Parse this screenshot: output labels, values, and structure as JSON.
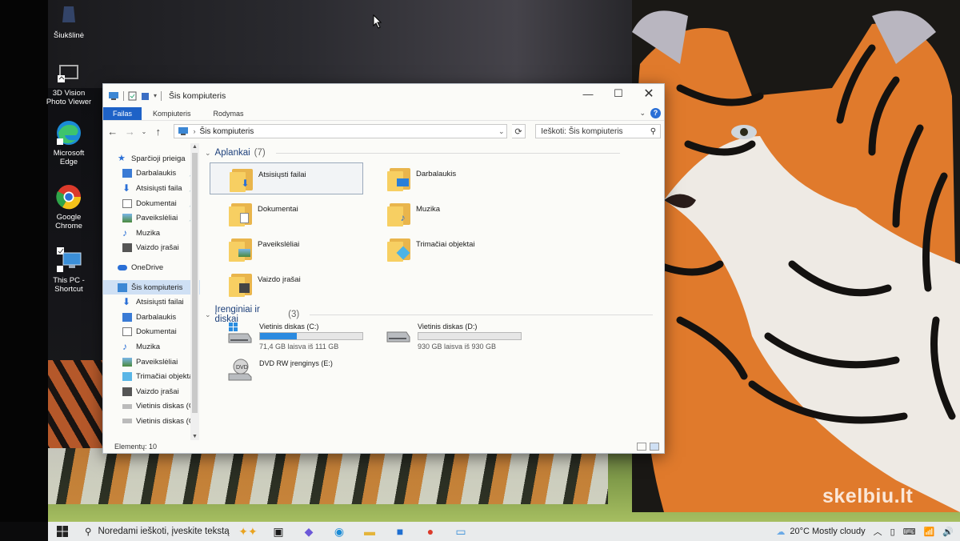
{
  "desktop": {
    "icons": [
      {
        "name": "recycle-bin",
        "label": "Šiukšlinė"
      },
      {
        "name": "3d-vision-photo-viewer",
        "label": "3D Vision Photo Viewer"
      },
      {
        "name": "microsoft-edge",
        "label": "Microsoft Edge"
      },
      {
        "name": "google-chrome",
        "label": "Google Chrome"
      },
      {
        "name": "this-pc-shortcut",
        "label": "This PC - Shortcut"
      }
    ],
    "watermark": "skelbiu.lt"
  },
  "explorer": {
    "title": "Šis kompiuteris",
    "ribbon_tabs": [
      "Failas",
      "Kompiuteris",
      "Rodymas"
    ],
    "address": "Šis kompiuteris",
    "search_placeholder": "Ieškoti: Šis kompiuteris",
    "nav": {
      "quick_access": "Sparčioji prieiga",
      "quick_items": [
        "Darbalaukis",
        "Atsisiųsti faila",
        "Dokumentai",
        "Paveikslėliai",
        "Muzika",
        "Vaizdo įrašai"
      ],
      "onedrive": "OneDrive",
      "this_pc": "Šis kompiuteris",
      "pc_items": [
        "Atsisiųsti failai",
        "Darbalaukis",
        "Dokumentai",
        "Muzika",
        "Paveikslėliai",
        "Trimačiai objekta",
        "Vaizdo įrašai",
        "Vietinis diskas (C",
        "Vietinis diskas (C"
      ]
    },
    "folders_group": {
      "title": "Aplankai",
      "count": "(7)"
    },
    "folders": [
      "Atsisiųsti failai",
      "Darbalaukis",
      "Dokumentai",
      "Muzika",
      "Paveikslėliai",
      "Trimačiai objektai",
      "Vaizdo įrašai"
    ],
    "devices_group": {
      "title": "Įrenginiai ir diskai",
      "count": "(3)"
    },
    "drives": [
      {
        "name": "Vietinis diskas (C:)",
        "free": "71,4 GB laisva iš 111 GB",
        "used_fraction": 0.36
      },
      {
        "name": "Vietinis diskas (D:)",
        "free": "930 GB laisva iš 930 GB",
        "used_fraction": 0.0
      },
      {
        "name": "DVD RW įrenginys (E:)"
      }
    ],
    "status": "Elementų: 10"
  },
  "taskbar": {
    "search_placeholder": "Noredami ieškoti, įveskite tekstą",
    "weather": "20°C  Mostly cloudy"
  },
  "colors": {
    "accent": "#1e62c7",
    "folder": "#f7cf62",
    "drive_bar": "#2b8ae0"
  }
}
